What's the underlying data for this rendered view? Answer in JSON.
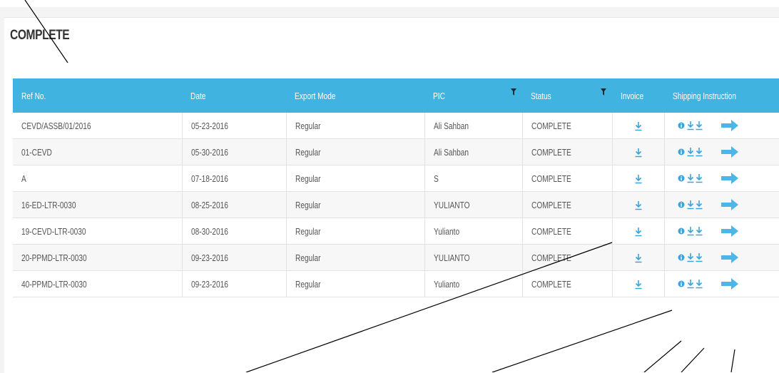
{
  "section": {
    "title": "COMPLETE"
  },
  "table": {
    "headers": [
      "Ref No.",
      "Date",
      "Export Mode",
      "PIC",
      "Status",
      "Invoice",
      "Shipping Instruction"
    ],
    "rows": [
      {
        "ref": "CEVD/ASSB/01/2016",
        "date": "05-23-2016",
        "mode": "Regular",
        "pic": "Ali Sahban",
        "status": "COMPLETE"
      },
      {
        "ref": "01-CEVD",
        "date": "05-30-2016",
        "mode": "Regular",
        "pic": "Ali Sahban",
        "status": "COMPLETE"
      },
      {
        "ref": "A",
        "date": "07-18-2016",
        "mode": "Regular",
        "pic": "S",
        "status": "COMPLETE"
      },
      {
        "ref": "16-ED-LTR-0030",
        "date": "08-25-2016",
        "mode": "Regular",
        "pic": "YULIANTO",
        "status": "COMPLETE"
      },
      {
        "ref": "19-CEVD-LTR-0030",
        "date": "08-30-2016",
        "mode": "Regular",
        "pic": "Yulianto",
        "status": "COMPLETE"
      },
      {
        "ref": "20-PPMD-LTR-0030",
        "date": "09-23-2016",
        "mode": "Regular",
        "pic": "YULIANTO",
        "status": "COMPLETE"
      },
      {
        "ref": "40-PPMD-LTR-0030",
        "date": "09-23-2016",
        "mode": "Regular",
        "pic": "Yulianto",
        "status": "COMPLETE"
      }
    ]
  },
  "icons": {
    "filter": "filter-icon",
    "download": "download-icon",
    "info": "info-icon",
    "arrow": "arrow-right-icon"
  },
  "colors": {
    "header_bg": "#41b3e0",
    "icon_blue": "#3aa4dc",
    "arrow_blue": "#4db6e8"
  }
}
